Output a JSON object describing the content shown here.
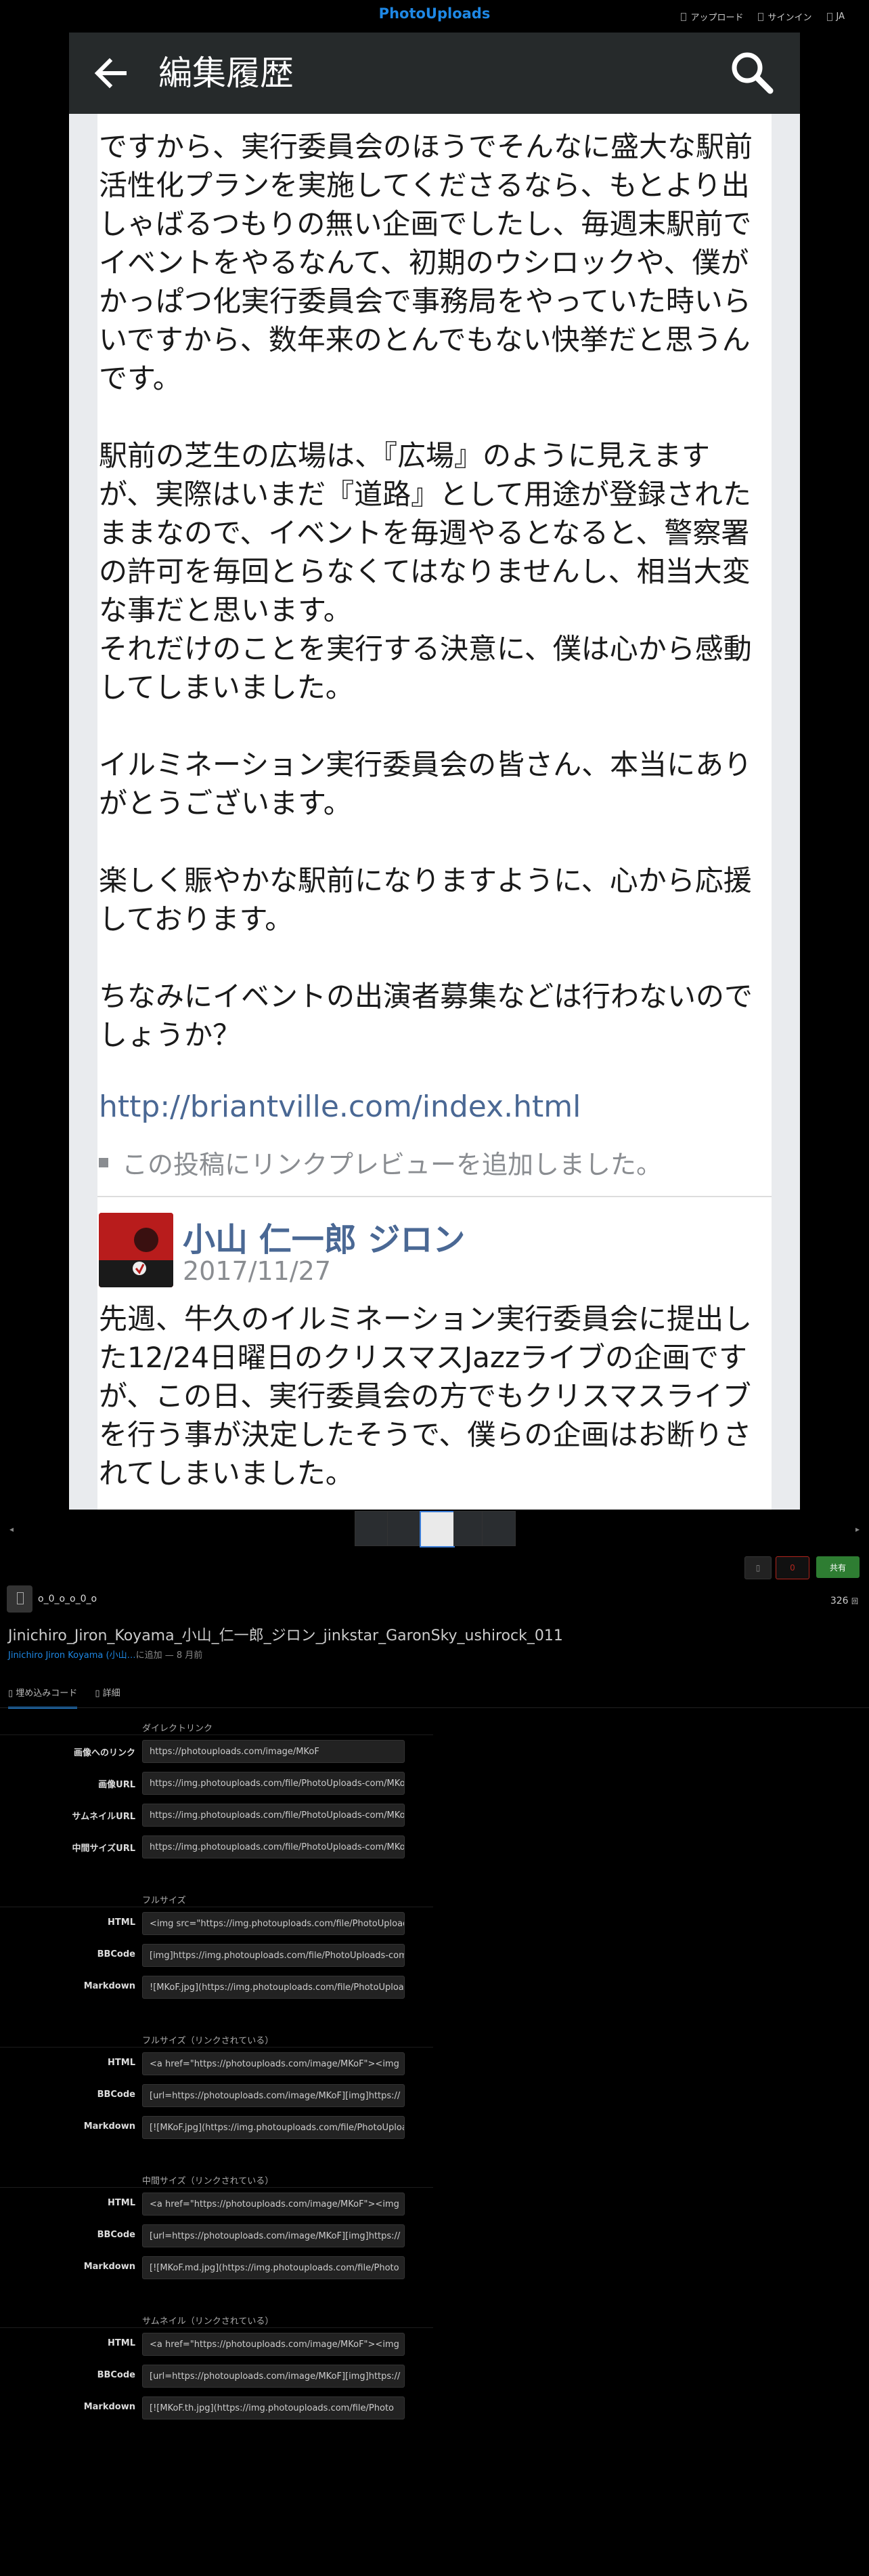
{
  "site": {
    "logo": "PhotoUploads",
    "nav": [
      "アップロード",
      "サインイン",
      "JA"
    ]
  },
  "photo": {
    "bar_title": "編集履歴",
    "post_text": "ですから、実行委員会のほうでそんなに盛大な駅前活性化プランを実施してくださるなら、もとより出しゃばるつもりの無い企画でしたし、毎週末駅前でイベントをやるなんて、初期のウシロックや、僕がかっぱつ化実行委員会で事務局をやっていた時いらいですから、数年来のとんでもない快挙だと思うんです。\n\n駅前の芝生の広場は、『広場』のように見えますが、実際はいまだ『道路』として用途が登録されたままなので、イベントを毎週やるとなると、警察署の許可を毎回とらなくてはなりませんし、相当大変な事だと思います。\nそれだけのことを実行する決意に、僕は心から感動してしまいました。\n\nイルミネーション実行委員会の皆さん、本当にありがとうございます。\n\n楽しく賑やかな駅前になりますように、心から応援しております。\n\nちなみにイベントの出演者募集などは行わないのでしょうか？",
    "link": "http://briantville.com/index.html",
    "preview_note": "この投稿にリンクプレビューを追加しました。",
    "author": "小山 仁一郎 ジロン",
    "date": "2017/11/27",
    "comment_text": "先週、牛久のイルミネーション実行委員会に提出した12/24日曜日のクリスマスJazzライブの企画ですが、この日、実行委員会の方でもクリスマスライブを行う事が決定したそうで、僕らの企画はお断りされてしまいました。"
  },
  "actions": {
    "count": "0",
    "share": "共有"
  },
  "meta": {
    "username": "o_0_o_o_0_o",
    "views": "326",
    "views_unit": "回",
    "title": "Jinichiro_Jiron_Koyama_小山_仁一郎_ジロン_jinkstar_GaronSky_ushirock_011",
    "added_by": "Jinichiro Jiron Koyama (小山…",
    "added_time": "に追加 — 8 月前"
  },
  "tabs": [
    "埋め込みコード",
    "詳細"
  ],
  "sections": [
    {
      "label": "ダイレクトリンク",
      "rows": [
        {
          "label": "画像へのリンク",
          "value": "https://photouploads.com/image/MKoF"
        },
        {
          "label": "画像URL",
          "value": "https://img.photouploads.com/file/PhotoUploads-com/MKoF.jpg"
        },
        {
          "label": "サムネイルURL",
          "value": "https://img.photouploads.com/file/PhotoUploads-com/MKoF.th.jpg"
        },
        {
          "label": "中間サイズURL",
          "value": "https://img.photouploads.com/file/PhotoUploads-com/MKoF.md.jpg"
        }
      ]
    },
    {
      "label": "フルサイズ",
      "rows": [
        {
          "label": "HTML",
          "value": "<img src=\"https://img.photouploads.com/file/PhotoUploads-com/MKoF.jpg\">"
        },
        {
          "label": "BBCode",
          "value": "[img]https://img.photouploads.com/file/PhotoUploads-com/MKoF.jpg[/img]"
        },
        {
          "label": "Markdown",
          "value": "![MKoF.jpg](https://img.photouploads.com/file/PhotoUploads-com/MKoF.jpg)"
        }
      ]
    },
    {
      "label": "フルサイズ（リンクされている）",
      "rows": [
        {
          "label": "HTML",
          "value": "<a href=\"https://photouploads.com/image/MKoF\"><img"
        },
        {
          "label": "BBCode",
          "value": "[url=https://photouploads.com/image/MKoF][img]https://"
        },
        {
          "label": "Markdown",
          "value": "[![MKoF.jpg](https://img.photouploads.com/file/PhotoUploads"
        }
      ]
    },
    {
      "label": "中間サイズ（リンクされている）",
      "rows": [
        {
          "label": "HTML",
          "value": "<a href=\"https://photouploads.com/image/MKoF\"><img"
        },
        {
          "label": "BBCode",
          "value": "[url=https://photouploads.com/image/MKoF][img]https://"
        },
        {
          "label": "Markdown",
          "value": "[![MKoF.md.jpg](https://img.photouploads.com/file/Photo"
        }
      ]
    },
    {
      "label": "サムネイル（リンクされている）",
      "rows": [
        {
          "label": "HTML",
          "value": "<a href=\"https://photouploads.com/image/MKoF\"><img"
        },
        {
          "label": "BBCode",
          "value": "[url=https://photouploads.com/image/MKoF][img]https://"
        },
        {
          "label": "Markdown",
          "value": "[![MKoF.th.jpg](https://img.photouploads.com/file/Photo"
        }
      ]
    }
  ],
  "colors": {
    "accent": "#1e88e5",
    "share": "#2e7d32",
    "like": "#b3261e"
  }
}
